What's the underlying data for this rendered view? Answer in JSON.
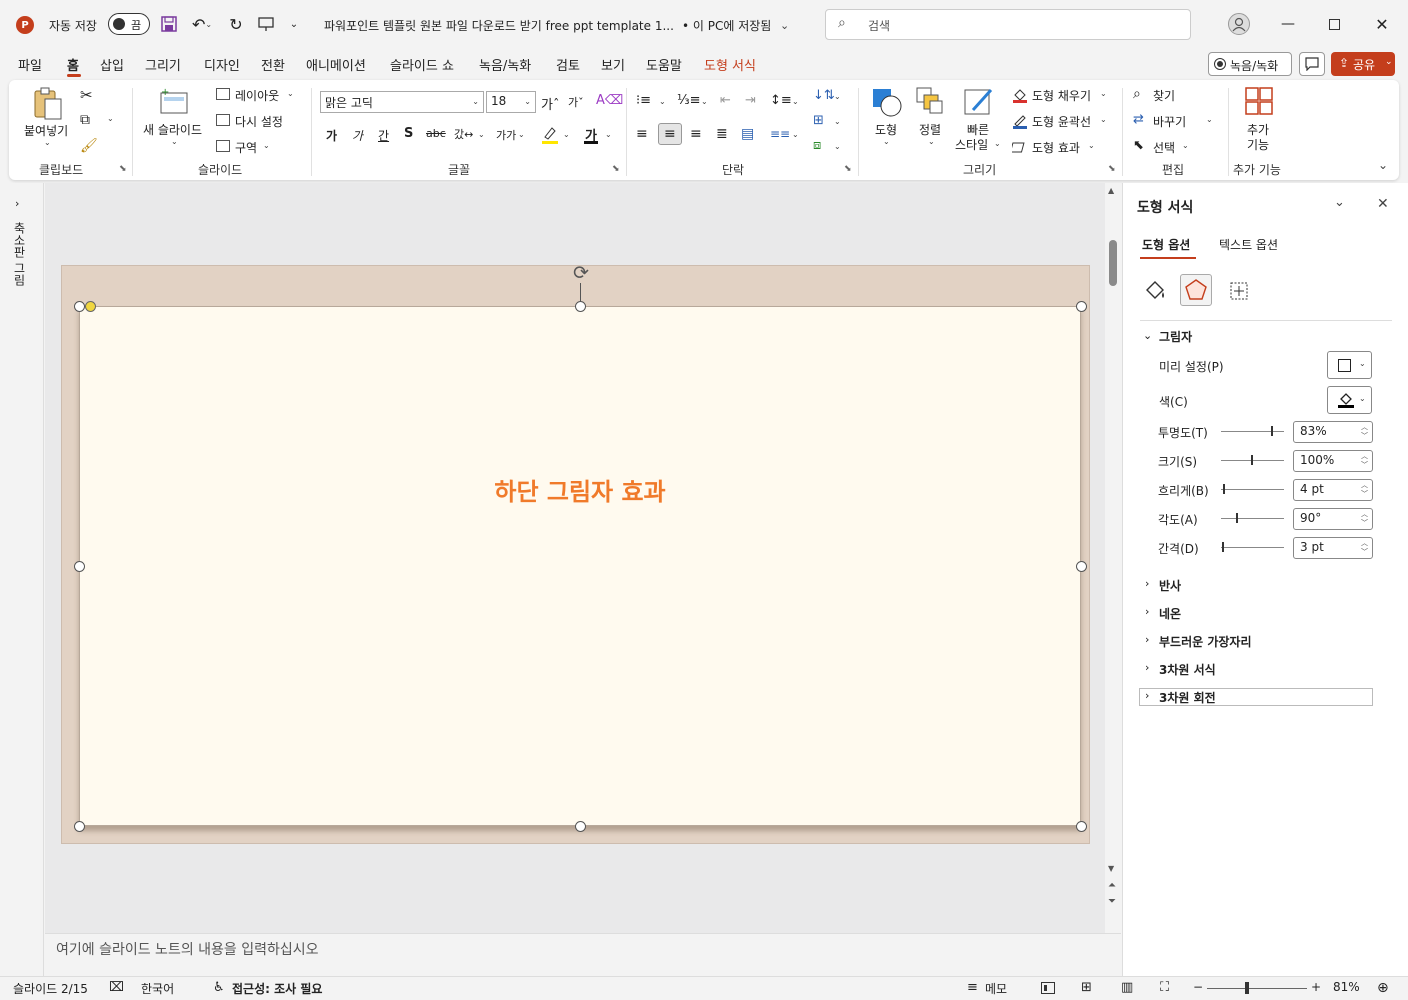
{
  "titlebar": {
    "autosave_label": "자동 저장",
    "autosave_state": "끔",
    "doc_title": "파워포인트 템플릿 원본 파일 다운로드 받기 free ppt template 1...",
    "save_status": "• 이 PC에 저장됨",
    "search_placeholder": "검색",
    "app_color": "#c43e1c"
  },
  "menu": {
    "items": [
      "파일",
      "홈",
      "삽입",
      "그리기",
      "디자인",
      "전환",
      "애니메이션",
      "슬라이드 쇼",
      "녹음/녹화",
      "검토",
      "보기",
      "도움말",
      "도형 서식"
    ],
    "active": "홈",
    "record_button": "녹음/녹화",
    "share_button": "공유"
  },
  "ribbon": {
    "clipboard": {
      "paste": "붙여넣기",
      "group": "클립보드"
    },
    "slides": {
      "new_slide": "새 슬라이드",
      "layout": "레이아웃",
      "reset": "다시 설정",
      "section": "구역",
      "group": "슬라이드"
    },
    "font": {
      "font_name": "맑은 고딕",
      "font_size": "18",
      "group": "글꼴"
    },
    "paragraph": {
      "group": "단락"
    },
    "drawing": {
      "shapes": "도형",
      "arrange": "정렬",
      "quick_styles_1": "빠른",
      "quick_styles_2": "스타일",
      "fill": "도형 채우기",
      "outline": "도형 윤곽선",
      "effects": "도형 효과",
      "group": "그리기"
    },
    "editing": {
      "find": "찾기",
      "replace": "바꾸기",
      "select": "선택",
      "group": "편집"
    },
    "addins": {
      "label_1": "추가",
      "label_2": "기능",
      "group": "추가 기능"
    }
  },
  "left_panel": {
    "label": "축소판 그림"
  },
  "slide": {
    "text": "하단 그림자 효과",
    "text_color": "#f07a2a",
    "bg_color": "#e2d2c4",
    "shape_fill": "#fffaef"
  },
  "notes": {
    "placeholder": "여기에 슬라이드 노트의 내용을 입력하십시오"
  },
  "pane": {
    "title": "도형 서식",
    "tabs": [
      "도형 옵션",
      "텍스트 옵션"
    ],
    "active_tab": "도형 옵션",
    "shadow_section": "그림자",
    "preset_label": "미리 설정(P)",
    "color_label": "색(C)",
    "transparency_label": "투명도(T)",
    "transparency_value": "83%",
    "size_label": "크기(S)",
    "size_value": "100%",
    "blur_label": "흐리게(B)",
    "blur_value": "4 pt",
    "angle_label": "각도(A)",
    "angle_value": "90°",
    "distance_label": "간격(D)",
    "distance_value": "3 pt",
    "collapsed_sections": [
      "반사",
      "네온",
      "부드러운 가장자리",
      "3차원 서식",
      "3차원 회전"
    ]
  },
  "status": {
    "slide_info": "슬라이드 2/15",
    "language": "한국어",
    "accessibility": "접근성: 조사 필요",
    "notes_button": "메모",
    "zoom": "81%"
  }
}
